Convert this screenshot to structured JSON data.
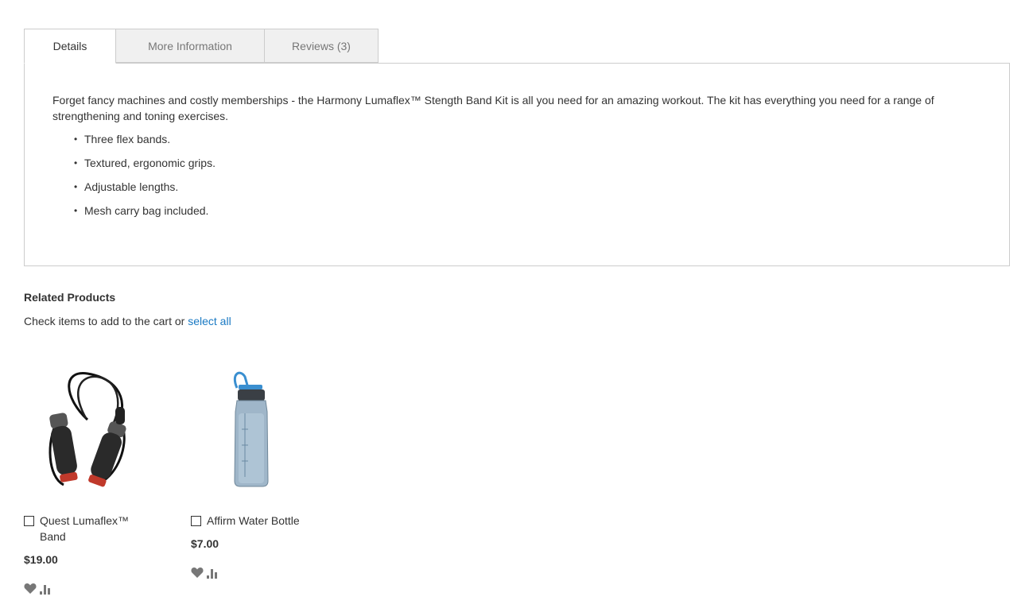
{
  "tabs": [
    {
      "label": "Details"
    },
    {
      "label": "More Information"
    },
    {
      "label": "Reviews (3)"
    }
  ],
  "details": {
    "description": "Forget fancy machines and costly memberships - the Harmony Lumaflex™ Stength Band Kit is all you need for an amazing workout. The kit has everything you need for a range of strengthening and toning exercises.",
    "features": [
      "Three flex bands.",
      "Textured, ergonomic grips.",
      "Adjustable lengths.",
      "Mesh carry bag included."
    ]
  },
  "related": {
    "title": "Related Products",
    "check_text": "Check items to add to the cart or ",
    "select_all": "select all",
    "products": [
      {
        "name": "Quest Lumaflex™ Band",
        "price": "$19.00",
        "image_icon": "jump-rope-band-image"
      },
      {
        "name": "Affirm Water Bottle",
        "price": "$7.00",
        "image_icon": "water-bottle-image"
      }
    ]
  },
  "colors": {
    "link": "#1979c3",
    "tab_inactive_bg": "#f0f0f0",
    "border": "#cccccc",
    "icon": "#777777"
  }
}
